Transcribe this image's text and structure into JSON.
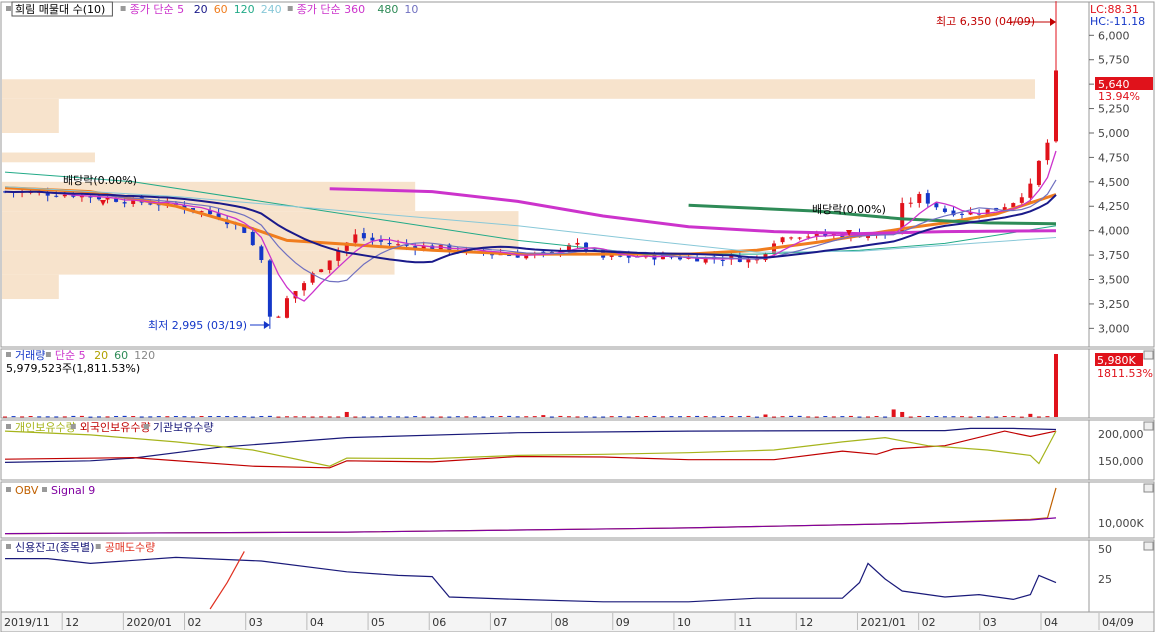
{
  "colors": {
    "up": "#e0121b",
    "down": "#1437c8",
    "ma5": "#cc33cc",
    "ma20": "#1a1a8a",
    "ma60": "#f07d1e",
    "ma120": "#22aa88",
    "ma240": "#88c8d8",
    "ma360": "#cc33cc",
    "ma480": "#2e8b57",
    "ma10": "#7070c0",
    "profile": "#f7e3cc",
    "individual": "#a6b41c",
    "foreign": "#c00000",
    "inst": "#1a1a7a",
    "obv": "#c06000",
    "signal": "#8000a0",
    "credit": "#1a1a7a",
    "short": "#e03020"
  },
  "price_panel": {
    "legend": [
      {
        "text": "희림 매물대 수(10)",
        "color": "#000000",
        "boxed": true
      },
      {
        "text": "종가 단순 5",
        "color": "#cc33cc"
      },
      {
        "text": "20",
        "color": "#1a1a8a"
      },
      {
        "text": "60",
        "color": "#f07d1e"
      },
      {
        "text": "120",
        "color": "#22aa88"
      },
      {
        "text": "240",
        "color": "#88c8d8"
      },
      {
        "text": "종가 단순 360",
        "color": "#cc33cc"
      },
      {
        "text": "480",
        "color": "#2e8b57"
      },
      {
        "text": "10",
        "color": "#7070c0"
      }
    ],
    "lc_label": "LC:88.31",
    "hc_label": "HC:-11.18",
    "current_price": "5,640",
    "change_pct": "13.94%",
    "high_note": "최고 6,350 (04/09)",
    "low_note": "최저 2,995 (03/19)",
    "dividend_notes": [
      "배당락(0.00%)",
      "배당락(0.00%)"
    ]
  },
  "volume_panel": {
    "legend": [
      {
        "text": "거래량",
        "color": "#1437c8"
      },
      {
        "text": "단순 5",
        "color": "#cc33cc"
      },
      {
        "text": "20",
        "color": "#b0a000"
      },
      {
        "text": "60",
        "color": "#2e8b57"
      },
      {
        "text": "120",
        "color": "#888888"
      }
    ],
    "info": "5,979,523주(1,811.53%)",
    "last_value": "5,980K",
    "last_pct": "1811.53%"
  },
  "holders_panel": {
    "legend": [
      {
        "text": "개인보유수량",
        "color": "#a6b41c"
      },
      {
        "text": "외국인보유수량",
        "color": "#c00000"
      },
      {
        "text": "기관보유수량",
        "color": "#1a1a7a"
      }
    ]
  },
  "obv_panel": {
    "legend": [
      {
        "text": "OBV",
        "color": "#c06000"
      },
      {
        "text": "Signal 9",
        "color": "#8000a0"
      }
    ]
  },
  "credit_panel": {
    "legend": [
      {
        "text": "신용잔고(종목별)",
        "color": "#1a1a7a"
      },
      {
        "text": "공매도수량",
        "color": "#e03020"
      }
    ]
  },
  "chart_data": [
    {
      "type": "candlestick",
      "title": "희림",
      "y_axis_ticks": [
        "6,000",
        "5,750",
        "5,500",
        "5,250",
        "5,000",
        "4,750",
        "4,500",
        "4,250",
        "4,000",
        "3,750",
        "3,500",
        "3,250",
        "3,000"
      ],
      "ylim": [
        2850,
        6300
      ],
      "x_axis_labels": [
        "2019/11",
        "12",
        "2020/01",
        "02",
        "03",
        "04",
        "05",
        "06",
        "07",
        "08",
        "09",
        "10",
        "11",
        "12",
        "2021/01",
        "02",
        "03",
        "04",
        "04/09"
      ],
      "close_path": [
        [
          0,
          4400
        ],
        [
          8,
          4370
        ],
        [
          15,
          4300
        ],
        [
          20,
          4260
        ],
        [
          25,
          4150
        ],
        [
          28,
          4000
        ],
        [
          30,
          3700
        ],
        [
          31,
          3150
        ],
        [
          32,
          3100
        ],
        [
          33,
          3300
        ],
        [
          36,
          3550
        ],
        [
          39,
          3800
        ],
        [
          41,
          3950
        ],
        [
          43,
          3900
        ],
        [
          46,
          3850
        ],
        [
          50,
          3830
        ],
        [
          55,
          3780
        ],
        [
          60,
          3750
        ],
        [
          64,
          3760
        ],
        [
          66,
          3870
        ],
        [
          68,
          3820
        ],
        [
          70,
          3720
        ],
        [
          75,
          3740
        ],
        [
          80,
          3720
        ],
        [
          85,
          3720
        ],
        [
          88,
          3700
        ],
        [
          90,
          3900
        ],
        [
          92,
          3960
        ],
        [
          95,
          3950
        ],
        [
          100,
          3960
        ],
        [
          104,
          3970
        ],
        [
          105,
          4250
        ],
        [
          107,
          4350
        ],
        [
          110,
          4200
        ],
        [
          113,
          4180
        ],
        [
          116,
          4220
        ],
        [
          118,
          4300
        ],
        [
          120,
          4450
        ],
        [
          121,
          4700
        ],
        [
          122,
          4900
        ],
        [
          123,
          5640
        ]
      ],
      "ohlc_last": {
        "date": "04/09",
        "high": 6350,
        "close": 5640
      },
      "low_mark": {
        "date": "03/19",
        "value": 2995
      },
      "high_mark": {
        "date": "04/09",
        "value": 6350
      },
      "volume_profile_bands": [
        {
          "from": 5350,
          "to": 5550,
          "rel": 1.0
        },
        {
          "from": 5000,
          "to": 5350,
          "rel": 0.055
        },
        {
          "from": 4700,
          "to": 4800,
          "rel": 0.09
        },
        {
          "from": 4200,
          "to": 4500,
          "rel": 0.4
        },
        {
          "from": 3800,
          "to": 4200,
          "rel": 0.5
        },
        {
          "from": 3550,
          "to": 3800,
          "rel": 0.38
        },
        {
          "from": 3300,
          "to": 3550,
          "rel": 0.055
        }
      ],
      "ma_paths": [
        {
          "name": "60",
          "color": "#f07d1e",
          "points": [
            [
              0,
              4440
            ],
            [
              10,
              4400
            ],
            [
              20,
              4250
            ],
            [
              28,
              4050
            ],
            [
              33,
              3900
            ],
            [
              40,
              3860
            ],
            [
              50,
              3800
            ],
            [
              60,
              3760
            ],
            [
              70,
              3760
            ],
            [
              80,
              3760
            ],
            [
              88,
              3800
            ],
            [
              95,
              3880
            ],
            [
              100,
              3950
            ],
            [
              105,
              4020
            ],
            [
              110,
              4080
            ],
            [
              116,
              4170
            ],
            [
              123,
              4370
            ]
          ]
        },
        {
          "name": "120",
          "color": "#22aa88",
          "points": [
            [
              0,
              4600
            ],
            [
              15,
              4500
            ],
            [
              30,
              4300
            ],
            [
              45,
              4100
            ],
            [
              60,
              3900
            ],
            [
              75,
              3760
            ],
            [
              88,
              3760
            ],
            [
              100,
              3800
            ],
            [
              110,
              3870
            ],
            [
              123,
              4050
            ]
          ]
        },
        {
          "name": "240",
          "color": "#88c8d8",
          "points": [
            [
              0,
              4450
            ],
            [
              20,
              4350
            ],
            [
              40,
              4200
            ],
            [
              60,
              4050
            ],
            [
              75,
              3900
            ],
            [
              88,
              3780
            ],
            [
              100,
              3790
            ],
            [
              110,
              3850
            ],
            [
              123,
              3930
            ]
          ]
        },
        {
          "name": "360",
          "color": "#cc33cc",
          "points": [
            [
              38,
              4430
            ],
            [
              50,
              4400
            ],
            [
              60,
              4300
            ],
            [
              70,
              4150
            ],
            [
              80,
              4040
            ],
            [
              90,
              3990
            ],
            [
              100,
              3970
            ],
            [
              110,
              3990
            ],
            [
              123,
              4000
            ]
          ]
        },
        {
          "name": "480",
          "color": "#2e8b57",
          "points": [
            [
              80,
              4260
            ],
            [
              95,
              4200
            ],
            [
              105,
              4120
            ],
            [
              115,
              4080
            ],
            [
              123,
              4070
            ]
          ]
        }
      ]
    },
    {
      "type": "bar",
      "title": "거래량",
      "last_value": 5979523,
      "spikes": [
        [
          40,
          0.08
        ],
        [
          63,
          0.03
        ],
        [
          89,
          0.04
        ],
        [
          104,
          0.12
        ],
        [
          105,
          0.08
        ],
        [
          120,
          0.05
        ],
        [
          123,
          1.0
        ]
      ]
    },
    {
      "type": "line",
      "title": "보유수량",
      "y_axis_ticks": [
        "200,000",
        "150,000"
      ],
      "ylim": [
        120000,
        220000
      ],
      "series": [
        {
          "name": "기관보유수량",
          "color": "#1a1a7a",
          "points": [
            [
              0,
              147000
            ],
            [
              10,
              150000
            ],
            [
              15,
              155000
            ],
            [
              25,
              175000
            ],
            [
              40,
              193000
            ],
            [
              60,
              202000
            ],
            [
              80,
              205000
            ],
            [
              100,
              206000
            ],
            [
              110,
              206000
            ],
            [
              113,
              210000
            ],
            [
              118,
              210000
            ],
            [
              123,
              208000
            ]
          ]
        },
        {
          "name": "외국인보유수량",
          "color": "#c00000",
          "points": [
            [
              0,
              153000
            ],
            [
              15,
              156000
            ],
            [
              29,
              140000
            ],
            [
              38,
              137000
            ],
            [
              40,
              150000
            ],
            [
              50,
              148000
            ],
            [
              60,
              158000
            ],
            [
              70,
              157000
            ],
            [
              80,
              152000
            ],
            [
              90,
              152000
            ],
            [
              98,
              168000
            ],
            [
              102,
              162000
            ],
            [
              104,
              172000
            ],
            [
              110,
              178000
            ],
            [
              117,
              205000
            ],
            [
              120,
              195000
            ],
            [
              123,
              205000
            ]
          ]
        },
        {
          "name": "개인보유수량",
          "color": "#a6b41c",
          "points": [
            [
              0,
              205000
            ],
            [
              10,
              198000
            ],
            [
              20,
              185000
            ],
            [
              29,
              170000
            ],
            [
              38,
              140000
            ],
            [
              40,
              155000
            ],
            [
              50,
              154000
            ],
            [
              60,
              160000
            ],
            [
              70,
              162000
            ],
            [
              80,
              165000
            ],
            [
              90,
              170000
            ],
            [
              98,
              185000
            ],
            [
              103,
              193000
            ],
            [
              108,
              178000
            ],
            [
              115,
              170000
            ],
            [
              120,
              160000
            ],
            [
              121,
              145000
            ],
            [
              123,
              205000
            ]
          ]
        }
      ]
    },
    {
      "type": "line",
      "title": "OBV",
      "y_axis_ticks": [
        "10,000K"
      ],
      "series": [
        {
          "name": "OBV",
          "color": "#c06000",
          "points": [
            [
              0,
              -2
            ],
            [
              40,
              -1
            ],
            [
              80,
              2
            ],
            [
              105,
              5
            ],
            [
              120,
              8
            ],
            [
              122,
              9
            ],
            [
              123,
              30
            ]
          ]
        },
        {
          "name": "Signal 9",
          "color": "#8000a0",
          "points": [
            [
              0,
              -2
            ],
            [
              40,
              -1
            ],
            [
              80,
              2
            ],
            [
              105,
              5
            ],
            [
              120,
              7.5
            ],
            [
              123,
              9
            ]
          ]
        }
      ]
    },
    {
      "type": "line",
      "title": "신용잔고(종목별)",
      "y_axis_ticks": [
        "50",
        "25"
      ],
      "ylim": [
        0,
        55
      ],
      "series": [
        {
          "name": "신용잔고(종목별)",
          "color": "#1a1a7a",
          "points": [
            [
              0,
              42
            ],
            [
              5,
              42
            ],
            [
              10,
              38
            ],
            [
              20,
              43
            ],
            [
              30,
              40
            ],
            [
              40,
              31
            ],
            [
              46,
              28
            ],
            [
              50,
              27
            ],
            [
              52,
              10
            ],
            [
              60,
              8
            ],
            [
              70,
              6
            ],
            [
              80,
              6
            ],
            [
              88,
              9
            ],
            [
              98,
              9
            ],
            [
              100,
              22
            ],
            [
              101,
              38
            ],
            [
              103,
              25
            ],
            [
              105,
              15
            ],
            [
              110,
              10
            ],
            [
              114,
              12
            ],
            [
              118,
              8
            ],
            [
              120,
              12
            ],
            [
              121,
              28
            ],
            [
              123,
              22
            ]
          ]
        },
        {
          "name": "공매도수량",
          "color": "#e03020",
          "points": [
            [
              24,
              0
            ],
            [
              26,
              22
            ],
            [
              28,
              48
            ]
          ]
        }
      ]
    }
  ]
}
